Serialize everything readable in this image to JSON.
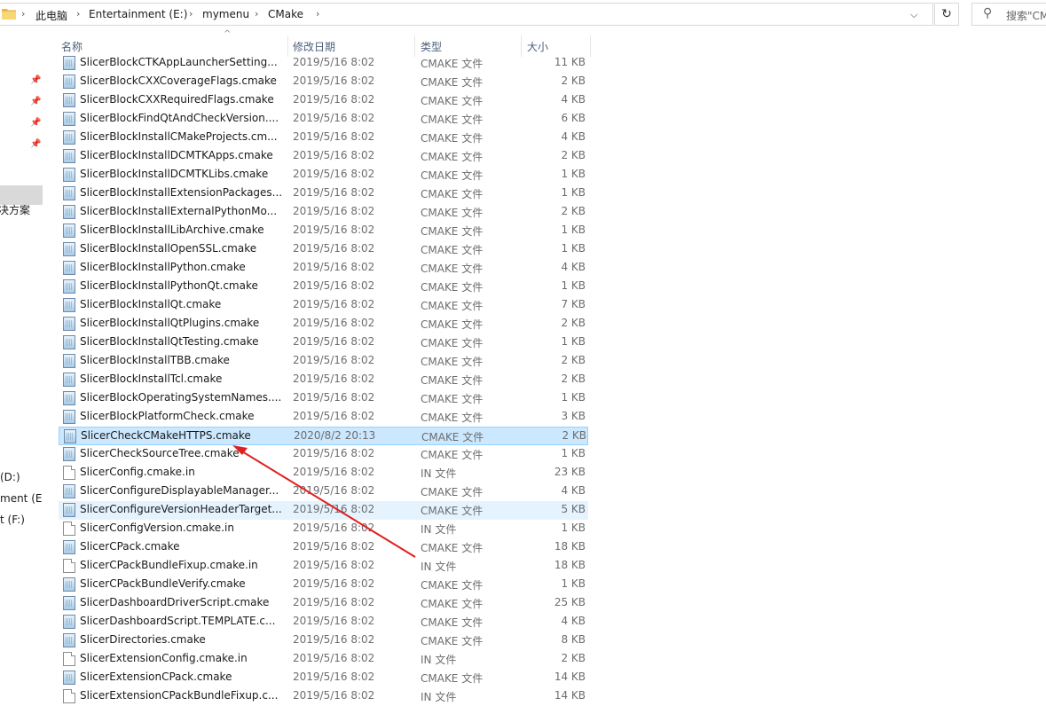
{
  "breadcrumb": [
    "此电脑",
    "Entertainment (E:)",
    "mymenu",
    "CMake"
  ],
  "search": {
    "placeholder": "搜索\"CMake\""
  },
  "nav": {
    "items": [
      "决方案",
      "(D:)",
      "ment (E:)",
      "t (F:)"
    ]
  },
  "columns": {
    "name": "名称",
    "date": "修改日期",
    "type": "类型",
    "size": "大小"
  },
  "files": [
    {
      "name": "SlicerBlockCTKAppLauncherSettings.cmake",
      "date": "2019/5/16 8:02",
      "type": "CMAKE 文件",
      "size": "11 KB",
      "icon": "cmake-file-icon"
    },
    {
      "name": "SlicerBlockCXXCoverageFlags.cmake",
      "date": "2019/5/16 8:02",
      "type": "CMAKE 文件",
      "size": "2 KB",
      "icon": "cmake-file-icon"
    },
    {
      "name": "SlicerBlockCXXRequiredFlags.cmake",
      "date": "2019/5/16 8:02",
      "type": "CMAKE 文件",
      "size": "4 KB",
      "icon": "cmake-file-icon"
    },
    {
      "name": "SlicerBlockFindQtAndCheckVersion.cmake",
      "date": "2019/5/16 8:02",
      "type": "CMAKE 文件",
      "size": "6 KB",
      "icon": "cmake-file-icon"
    },
    {
      "name": "SlicerBlockInstallCMakeProjects.cmake",
      "date": "2019/5/16 8:02",
      "type": "CMAKE 文件",
      "size": "4 KB",
      "icon": "cmake-file-icon"
    },
    {
      "name": "SlicerBlockInstallDCMTKApps.cmake",
      "date": "2019/5/16 8:02",
      "type": "CMAKE 文件",
      "size": "2 KB",
      "icon": "cmake-file-icon"
    },
    {
      "name": "SlicerBlockInstallDCMTKLibs.cmake",
      "date": "2019/5/16 8:02",
      "type": "CMAKE 文件",
      "size": "1 KB",
      "icon": "cmake-file-icon"
    },
    {
      "name": "SlicerBlockInstallExtensionPackages.cmake",
      "date": "2019/5/16 8:02",
      "type": "CMAKE 文件",
      "size": "1 KB",
      "icon": "cmake-file-icon"
    },
    {
      "name": "SlicerBlockInstallExternalPythonModules.cmake",
      "date": "2019/5/16 8:02",
      "type": "CMAKE 文件",
      "size": "2 KB",
      "icon": "cmake-file-icon"
    },
    {
      "name": "SlicerBlockInstallLibArchive.cmake",
      "date": "2019/5/16 8:02",
      "type": "CMAKE 文件",
      "size": "1 KB",
      "icon": "cmake-file-icon"
    },
    {
      "name": "SlicerBlockInstallOpenSSL.cmake",
      "date": "2019/5/16 8:02",
      "type": "CMAKE 文件",
      "size": "1 KB",
      "icon": "cmake-file-icon"
    },
    {
      "name": "SlicerBlockInstallPython.cmake",
      "date": "2019/5/16 8:02",
      "type": "CMAKE 文件",
      "size": "4 KB",
      "icon": "cmake-file-icon"
    },
    {
      "name": "SlicerBlockInstallPythonQt.cmake",
      "date": "2019/5/16 8:02",
      "type": "CMAKE 文件",
      "size": "1 KB",
      "icon": "cmake-file-icon"
    },
    {
      "name": "SlicerBlockInstallQt.cmake",
      "date": "2019/5/16 8:02",
      "type": "CMAKE 文件",
      "size": "7 KB",
      "icon": "cmake-file-icon"
    },
    {
      "name": "SlicerBlockInstallQtPlugins.cmake",
      "date": "2019/5/16 8:02",
      "type": "CMAKE 文件",
      "size": "2 KB",
      "icon": "cmake-file-icon"
    },
    {
      "name": "SlicerBlockInstallQtTesting.cmake",
      "date": "2019/5/16 8:02",
      "type": "CMAKE 文件",
      "size": "1 KB",
      "icon": "cmake-file-icon"
    },
    {
      "name": "SlicerBlockInstallTBB.cmake",
      "date": "2019/5/16 8:02",
      "type": "CMAKE 文件",
      "size": "2 KB",
      "icon": "cmake-file-icon"
    },
    {
      "name": "SlicerBlockInstallTcl.cmake",
      "date": "2019/5/16 8:02",
      "type": "CMAKE 文件",
      "size": "2 KB",
      "icon": "cmake-file-icon"
    },
    {
      "name": "SlicerBlockOperatingSystemNames.cmake",
      "date": "2019/5/16 8:02",
      "type": "CMAKE 文件",
      "size": "1 KB",
      "icon": "cmake-file-icon"
    },
    {
      "name": "SlicerBlockPlatformCheck.cmake",
      "date": "2019/5/16 8:02",
      "type": "CMAKE 文件",
      "size": "3 KB",
      "icon": "cmake-file-icon"
    },
    {
      "name": "SlicerCheckCMakeHTTPS.cmake",
      "date": "2020/8/2 20:13",
      "type": "CMAKE 文件",
      "size": "2 KB",
      "icon": "cmake-file-icon",
      "state": "selected"
    },
    {
      "name": "SlicerCheckSourceTree.cmake",
      "date": "2019/5/16 8:02",
      "type": "CMAKE 文件",
      "size": "1 KB",
      "icon": "cmake-file-icon"
    },
    {
      "name": "SlicerConfig.cmake.in",
      "date": "2019/5/16 8:02",
      "type": "IN 文件",
      "size": "23 KB",
      "icon": "document-icon"
    },
    {
      "name": "SlicerConfigureDisplayableManagerObjectFactory.cmake",
      "date": "2019/5/16 8:02",
      "type": "CMAKE 文件",
      "size": "4 KB",
      "icon": "cmake-file-icon"
    },
    {
      "name": "SlicerConfigureVersionHeaderTarget.cmake",
      "date": "2019/5/16 8:02",
      "type": "CMAKE 文件",
      "size": "5 KB",
      "icon": "cmake-file-icon",
      "state": "hover"
    },
    {
      "name": "SlicerConfigVersion.cmake.in",
      "date": "2019/5/16 8:02",
      "type": "IN 文件",
      "size": "1 KB",
      "icon": "document-icon"
    },
    {
      "name": "SlicerCPack.cmake",
      "date": "2019/5/16 8:02",
      "type": "CMAKE 文件",
      "size": "18 KB",
      "icon": "cmake-file-icon"
    },
    {
      "name": "SlicerCPackBundleFixup.cmake.in",
      "date": "2019/5/16 8:02",
      "type": "IN 文件",
      "size": "18 KB",
      "icon": "document-icon"
    },
    {
      "name": "SlicerCPackBundleVerify.cmake",
      "date": "2019/5/16 8:02",
      "type": "CMAKE 文件",
      "size": "1 KB",
      "icon": "cmake-file-icon"
    },
    {
      "name": "SlicerDashboardDriverScript.cmake",
      "date": "2019/5/16 8:02",
      "type": "CMAKE 文件",
      "size": "25 KB",
      "icon": "cmake-file-icon"
    },
    {
      "name": "SlicerDashboardScript.TEMPLATE.cmake",
      "date": "2019/5/16 8:02",
      "type": "CMAKE 文件",
      "size": "4 KB",
      "icon": "cmake-file-icon"
    },
    {
      "name": "SlicerDirectories.cmake",
      "date": "2019/5/16 8:02",
      "type": "CMAKE 文件",
      "size": "8 KB",
      "icon": "cmake-file-icon"
    },
    {
      "name": "SlicerExtensionConfig.cmake.in",
      "date": "2019/5/16 8:02",
      "type": "IN 文件",
      "size": "2 KB",
      "icon": "document-icon"
    },
    {
      "name": "SlicerExtensionCPack.cmake",
      "date": "2019/5/16 8:02",
      "type": "CMAKE 文件",
      "size": "14 KB",
      "icon": "cmake-file-icon"
    },
    {
      "name": "SlicerExtensionCPackBundleFixup.cmake.in",
      "date": "2019/5/16 8:02",
      "type": "IN 文件",
      "size": "14 KB",
      "icon": "document-icon"
    }
  ],
  "colors": {
    "selection": "#cce8ff",
    "hover": "#e5f3ff",
    "annotation_arrow": "#e02020"
  }
}
